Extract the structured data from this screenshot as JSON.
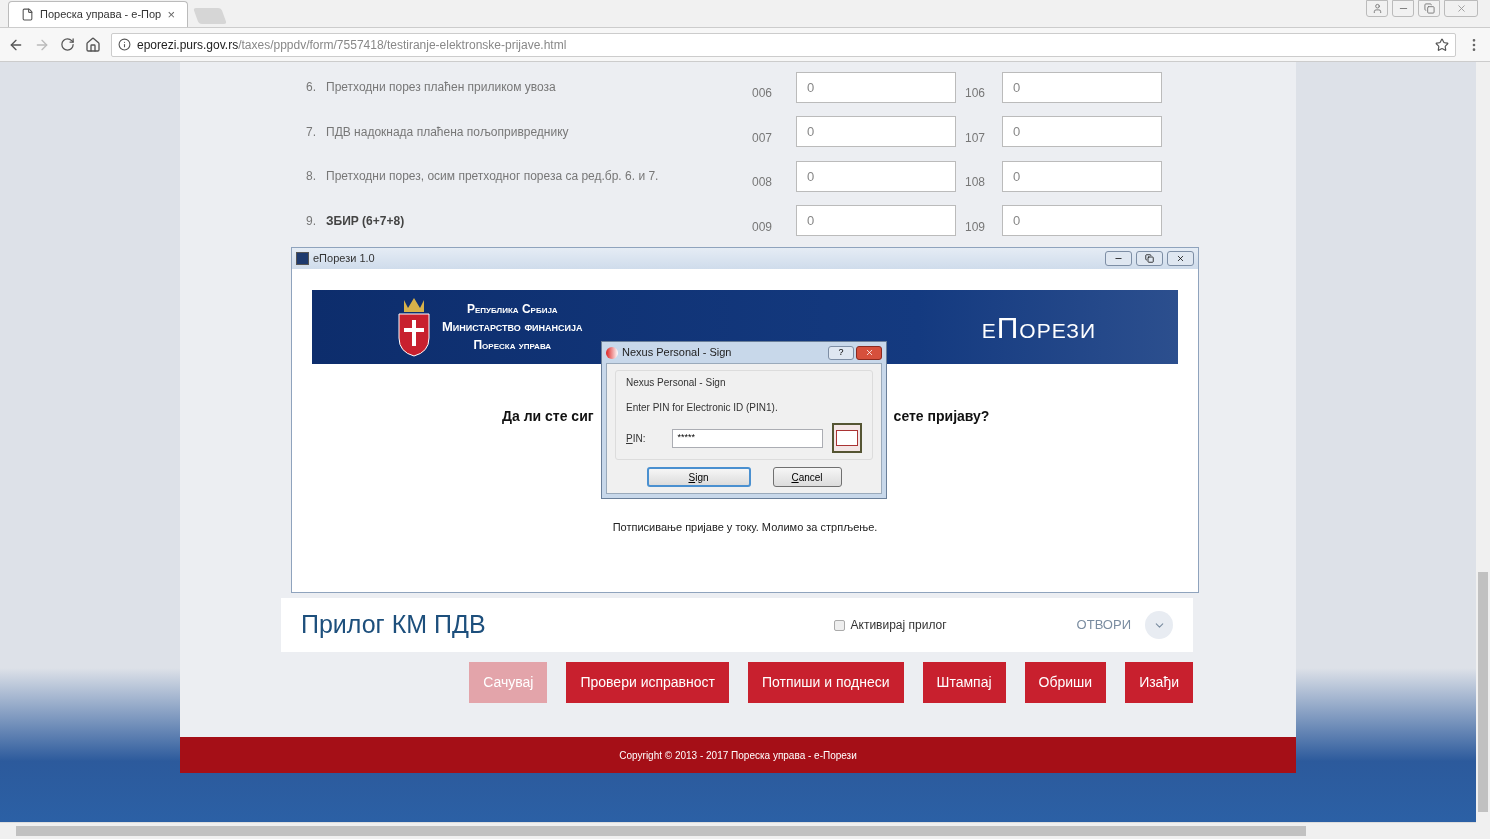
{
  "browser": {
    "tab": {
      "title": "Пореска управа - е-Пор",
      "close": "×"
    },
    "url": {
      "host": "eporezi.purs.gov.rs",
      "path": "/taxes/pppdv/form/7557418/testiranje-elektronske-prijave.html"
    }
  },
  "form_rows": [
    {
      "number": "6.",
      "label": "Претходни порез плаћен приликом увоза",
      "code_1": "006",
      "value_1": "0",
      "code_2": "106",
      "value_2": "0",
      "bold": false
    },
    {
      "number": "7.",
      "label": "ПДВ надокнада плаћена пољопривреднику",
      "code_1": "007",
      "value_1": "0",
      "code_2": "107",
      "value_2": "0",
      "bold": false
    },
    {
      "number": "8.",
      "label": "Претходни порез, осим претходног пореза са ред.бр. 6. и 7.",
      "code_1": "008",
      "value_1": "0",
      "code_2": "108",
      "value_2": "0",
      "bold": false
    },
    {
      "number": "9.",
      "label": "ЗБИР (6+7+8)",
      "code_1": "009",
      "value_1": "0",
      "code_2": "109",
      "value_2": "0",
      "bold": true
    }
  ],
  "eporezi_window": {
    "title": "еПорези 1.0",
    "banner": {
      "lines": [
        "Република Србија",
        "Министарство финансија",
        "Пореска управа"
      ],
      "brand": "еПорези"
    },
    "question_parts": [
      "Да ли сте сиг",
      "сете пријаву?"
    ],
    "status": "Потписивање пријаве у току. Молимо за стрпљење."
  },
  "sign_dialog": {
    "title": "Nexus Personal - Sign",
    "help": "?",
    "group_label": "Nexus Personal - Sign",
    "prompt": "Enter PIN for Electronic ID (PIN1).",
    "pin_label": "PIN:",
    "pin_value": "*****",
    "buttons": [
      {
        "label": "Sign",
        "default": true
      },
      {
        "label": "Cancel",
        "default": false
      }
    ]
  },
  "attachment": {
    "title": "Прилог КМ ПДВ",
    "activate": {
      "label": "Активирај прилог",
      "checked": false
    },
    "open": "ОТВОРИ"
  },
  "actions": [
    {
      "label": "Сачувај",
      "disabled": true
    },
    {
      "label": "Провери исправност",
      "disabled": false
    },
    {
      "label": "Потпиши и поднеси",
      "disabled": false
    },
    {
      "label": "Штампај",
      "disabled": false
    },
    {
      "label": "Обриши",
      "disabled": false
    },
    {
      "label": "Изађи",
      "disabled": false
    }
  ],
  "footer": "Copyright © 2013 - 2017 Пореска управа - е-Порези"
}
